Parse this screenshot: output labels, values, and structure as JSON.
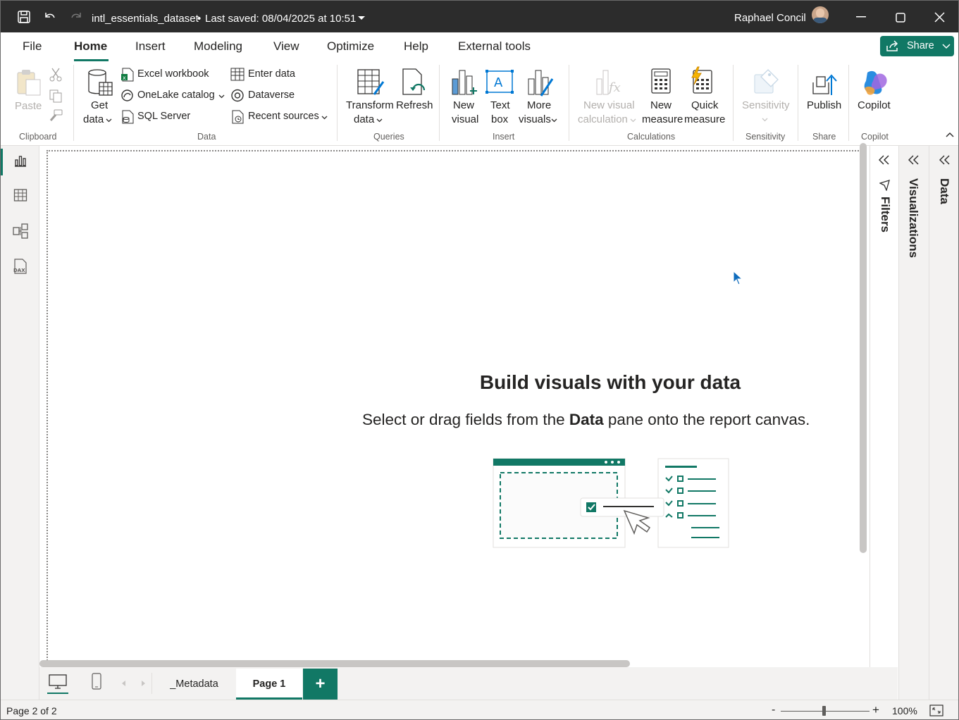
{
  "titlebar": {
    "file_name": "intl_essentials_dataset",
    "save_status": "Last saved: 08/04/2025 at 10:51",
    "user_name": "Raphael Concil"
  },
  "menu": {
    "tabs": [
      "File",
      "Home",
      "Insert",
      "Modeling",
      "View",
      "Optimize",
      "Help",
      "External tools"
    ],
    "share_label": "Share"
  },
  "ribbon": {
    "clipboard": {
      "paste": "Paste",
      "group": "Clipboard"
    },
    "data": {
      "get_data": "Get",
      "get_data2": "data",
      "excel": "Excel workbook",
      "onelake": "OneLake catalog",
      "sql": "SQL Server",
      "enter_data": "Enter data",
      "dataverse": "Dataverse",
      "recent": "Recent sources",
      "group": "Data"
    },
    "queries": {
      "transform": "Transform",
      "transform2": "data",
      "refresh": "Refresh",
      "group": "Queries"
    },
    "insert": {
      "new_visual": "New",
      "new_visual2": "visual",
      "text_box": "Text",
      "text_box2": "box",
      "more": "More",
      "more2": "visuals",
      "group": "Insert"
    },
    "calculations": {
      "nvc": "New visual",
      "nvc2": "calculation",
      "new_measure": "New",
      "new_measure2": "measure",
      "quick": "Quick",
      "quick2": "measure",
      "group": "Calculations"
    },
    "sensitivity": {
      "label": "Sensitivity",
      "group": "Sensitivity"
    },
    "share": {
      "publish": "Publish",
      "group": "Share"
    },
    "copilot": {
      "label": "Copilot",
      "group": "Copilot"
    }
  },
  "canvas": {
    "title": "Build visuals with your data",
    "sub_before": "Select or drag fields from the ",
    "sub_bold": "Data",
    "sub_after": " pane onto the report canvas."
  },
  "panes": {
    "filters": "Filters",
    "visualizations": "Visualizations",
    "data": "Data"
  },
  "pages": {
    "tabs": [
      "_Metadata",
      "Page 1"
    ],
    "active": "Page 1",
    "add": "+"
  },
  "status": {
    "page_info": "Page 2 of 2",
    "zoom": "100%",
    "zoom_minus": "-",
    "zoom_plus": "+"
  },
  "colors": {
    "accent": "#117865",
    "titlebar": "#2c2c2c"
  }
}
